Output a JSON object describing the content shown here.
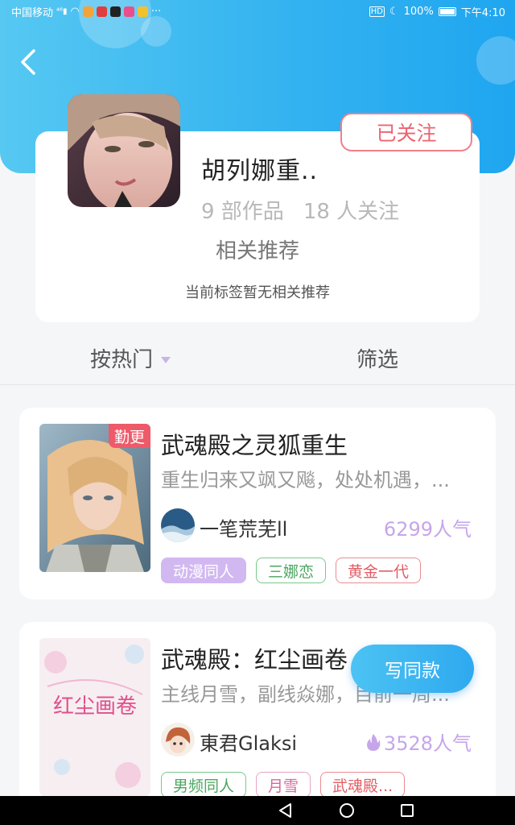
{
  "status_bar": {
    "carrier": "中国移动",
    "signal": "⁴⁶",
    "battery": "100%",
    "time": "下午4:10",
    "more": "···"
  },
  "header": {
    "back_icon": "chevron-left-icon",
    "tag_name": "胡列娜重..",
    "works_count": "9 部作品",
    "followers_count": "18 人关注",
    "follow_button": "已关注",
    "related_title": "相关推荐",
    "related_empty": "当前标签暂无相关推荐"
  },
  "sort": {
    "hot_label": "按热门",
    "filter_label": "筛选"
  },
  "works": [
    {
      "title": "武魂殿之灵狐重生",
      "desc": "重生归来又飒又飚，处处机遇，...",
      "author": "一笔荒芜ll",
      "popularity": "6299人气",
      "badge": "勤更",
      "tags": [
        "动漫同人",
        "三娜恋",
        "黄金一代"
      ]
    },
    {
      "title": "武魂殿：红尘画卷",
      "desc": "主线月雪，副线焱娜，目前一周...",
      "author": "東君Glaksi",
      "popularity": "3528人气",
      "cover_text": "红尘画卷",
      "tags": [
        "男频同人",
        "月雪",
        "武魂殿..."
      ]
    }
  ],
  "fab": {
    "write_label": "写同款"
  },
  "colors": {
    "header_blue": "#34b3f0",
    "follow_red": "#ec6471",
    "popularity_purple": "#c6a6ea",
    "update_badge": "#ef5a6a"
  }
}
